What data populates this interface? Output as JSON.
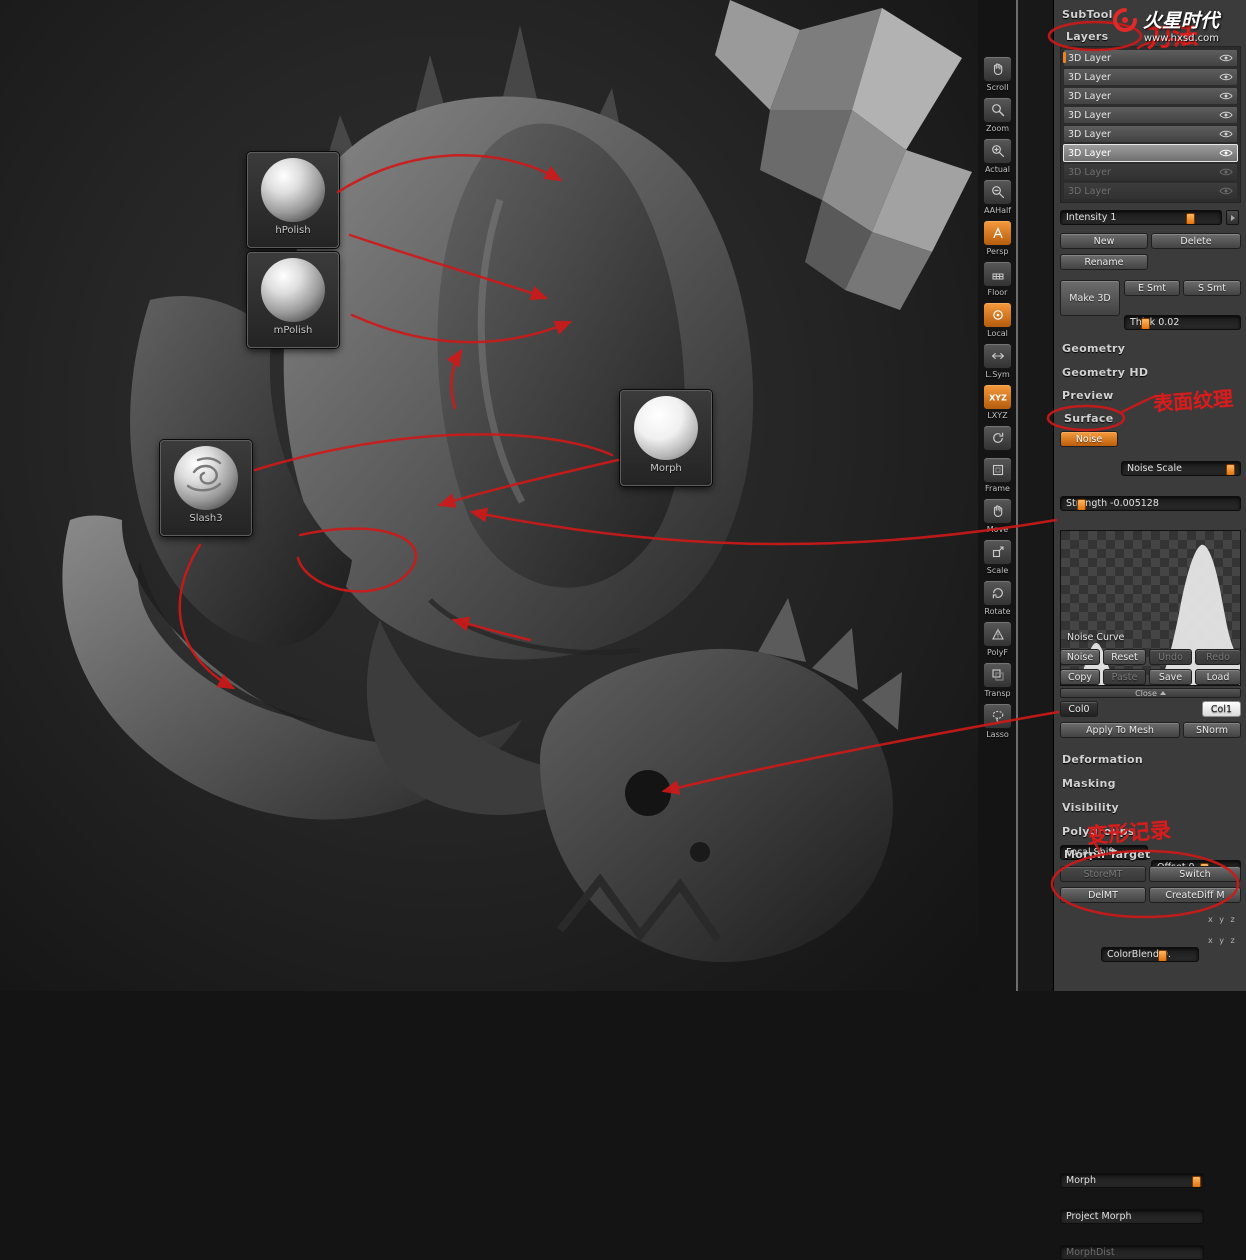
{
  "logo": {
    "brand": "火星时代",
    "site": "www.hxsd.com"
  },
  "red_notes": {
    "knife": "刀法",
    "surface": "表面纹理",
    "morph": "变形记录"
  },
  "brushes": {
    "hpolish": "hPolish",
    "mpolish": "mPolish",
    "slash3": "Slash3",
    "morph": "Morph"
  },
  "toolstrip": {
    "items": [
      {
        "label": "Scroll"
      },
      {
        "label": "Zoom"
      },
      {
        "label": "Actual"
      },
      {
        "label": "AAHalf"
      },
      {
        "label": "Persp"
      },
      {
        "label": "Floor"
      },
      {
        "label": "Local"
      },
      {
        "label": "L.Sym"
      },
      {
        "label": "LXYZ",
        "icon_text": "XYZ"
      },
      {
        "label": ""
      },
      {
        "label": "Frame"
      },
      {
        "label": "Move"
      },
      {
        "label": "Scale"
      },
      {
        "label": "Rotate"
      },
      {
        "label": "PolyF"
      },
      {
        "label": "Transp"
      },
      {
        "label": "Lasso"
      }
    ]
  },
  "panel": {
    "subtool": "SubTool",
    "layers": {
      "header": "Layers",
      "rows": [
        {
          "label": "3D Layer"
        },
        {
          "label": "3D Layer"
        },
        {
          "label": "3D Layer"
        },
        {
          "label": "3D Layer"
        },
        {
          "label": "3D Layer"
        },
        {
          "label": "3D Layer"
        },
        {
          "label": "3D Layer"
        },
        {
          "label": "3D Layer"
        }
      ],
      "intensity": "Intensity 1",
      "new": "New",
      "delete": "Delete",
      "rename": "Rename",
      "make3d": "Make 3D",
      "esmt": "E Smt",
      "ssmt": "S Smt",
      "thick": "Thick 0.02"
    },
    "headers": {
      "geometry": "Geometry",
      "geometry_hd": "Geometry HD",
      "preview": "Preview",
      "surface": "Surface",
      "deformation": "Deformation",
      "masking": "Masking",
      "visibility": "Visibility",
      "polygroups": "Polygroups",
      "morph_target": "Morph Target"
    },
    "surface": {
      "noise": "Noise",
      "noise_scale": "Noise Scale",
      "strength": "Strength -0.005128",
      "curve_label": "Noise Curve",
      "focal_shift": "Focal Shift",
      "offset": "Offset 0",
      "noise2": "Noise",
      "reset": "Reset",
      "undo": "Undo",
      "redo": "Redo",
      "copy": "Copy",
      "paste": "Paste",
      "save": "Save",
      "load": "Load",
      "close": "Close",
      "col0": "Col0",
      "colorblend": "ColorBlend 0.",
      "col1": "Col1",
      "apply": "Apply To Mesh",
      "snorm": "SNorm"
    },
    "morph": {
      "storemt": "StoreMT",
      "switch": "Switch",
      "delmt": "DelMT",
      "creatediff": "CreateDiff M",
      "morph": "Morph",
      "project": "Project Morph",
      "morphdist": "MorphDist",
      "xyz": "x y z"
    }
  }
}
